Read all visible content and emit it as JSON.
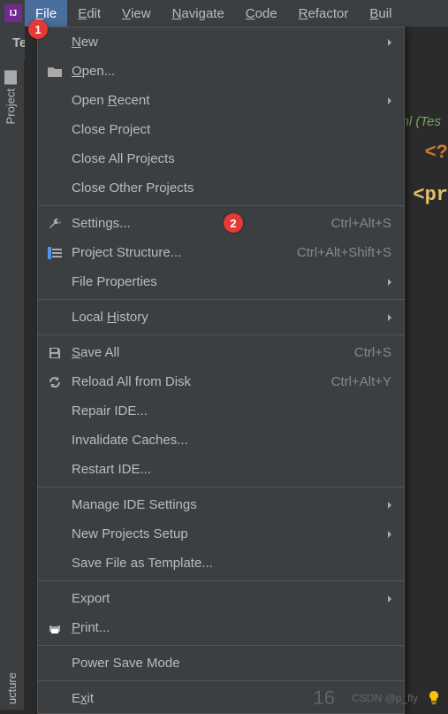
{
  "menubar": {
    "items": [
      "File",
      "Edit",
      "View",
      "Navigate",
      "Code",
      "Refactor",
      "Buil"
    ]
  },
  "breadcrumb": "Tes",
  "sidebar": {
    "project": "Project"
  },
  "editor": {
    "tab": "ml (Tes",
    "line1": "<?",
    "line2": "<pr",
    "gutter": "16"
  },
  "dropdown": {
    "groups": [
      [
        {
          "icon": "",
          "label": "New",
          "shortcut": "",
          "arrow": true,
          "u": 0
        },
        {
          "icon": "folder",
          "label": "Open...",
          "shortcut": "",
          "arrow": false,
          "u": 0
        },
        {
          "icon": "",
          "label": "Open Recent",
          "shortcut": "",
          "arrow": true,
          "u": 5
        },
        {
          "icon": "",
          "label": "Close Project",
          "shortcut": "",
          "arrow": false,
          "u": -1
        },
        {
          "icon": "",
          "label": "Close All Projects",
          "shortcut": "",
          "arrow": false,
          "u": -1
        },
        {
          "icon": "",
          "label": "Close Other Projects",
          "shortcut": "",
          "arrow": false,
          "u": -1
        }
      ],
      [
        {
          "icon": "wrench",
          "label": "Settings...",
          "shortcut": "Ctrl+Alt+S",
          "arrow": false,
          "u": -1,
          "badge": "2"
        },
        {
          "icon": "structure",
          "label": "Project Structure...",
          "shortcut": "Ctrl+Alt+Shift+S",
          "arrow": false,
          "u": -1
        },
        {
          "icon": "",
          "label": "File Properties",
          "shortcut": "",
          "arrow": true,
          "u": -1
        }
      ],
      [
        {
          "icon": "",
          "label": "Local History",
          "shortcut": "",
          "arrow": true,
          "u": 6
        }
      ],
      [
        {
          "icon": "save",
          "label": "Save All",
          "shortcut": "Ctrl+S",
          "arrow": false,
          "u": 0
        },
        {
          "icon": "reload",
          "label": "Reload All from Disk",
          "shortcut": "Ctrl+Alt+Y",
          "arrow": false,
          "u": -1
        },
        {
          "icon": "",
          "label": "Repair IDE...",
          "shortcut": "",
          "arrow": false,
          "u": -1
        },
        {
          "icon": "",
          "label": "Invalidate Caches...",
          "shortcut": "",
          "arrow": false,
          "u": -1
        },
        {
          "icon": "",
          "label": "Restart IDE...",
          "shortcut": "",
          "arrow": false,
          "u": -1
        }
      ],
      [
        {
          "icon": "",
          "label": "Manage IDE Settings",
          "shortcut": "",
          "arrow": true,
          "u": -1
        },
        {
          "icon": "",
          "label": "New Projects Setup",
          "shortcut": "",
          "arrow": true,
          "u": -1
        },
        {
          "icon": "",
          "label": "Save File as Template...",
          "shortcut": "",
          "arrow": false,
          "u": -1
        }
      ],
      [
        {
          "icon": "",
          "label": "Export",
          "shortcut": "",
          "arrow": true,
          "u": -1
        },
        {
          "icon": "print",
          "label": "Print...",
          "shortcut": "",
          "arrow": false,
          "u": 0
        }
      ],
      [
        {
          "icon": "",
          "label": "Power Save Mode",
          "shortcut": "",
          "arrow": false,
          "u": -1
        }
      ],
      [
        {
          "icon": "",
          "label": "Exit",
          "shortcut": "",
          "arrow": false,
          "u": 1
        }
      ]
    ]
  },
  "badges": {
    "one": "1",
    "two": "2"
  },
  "watermark": "CSDN @p_fly",
  "bottom_tab": "ucture"
}
